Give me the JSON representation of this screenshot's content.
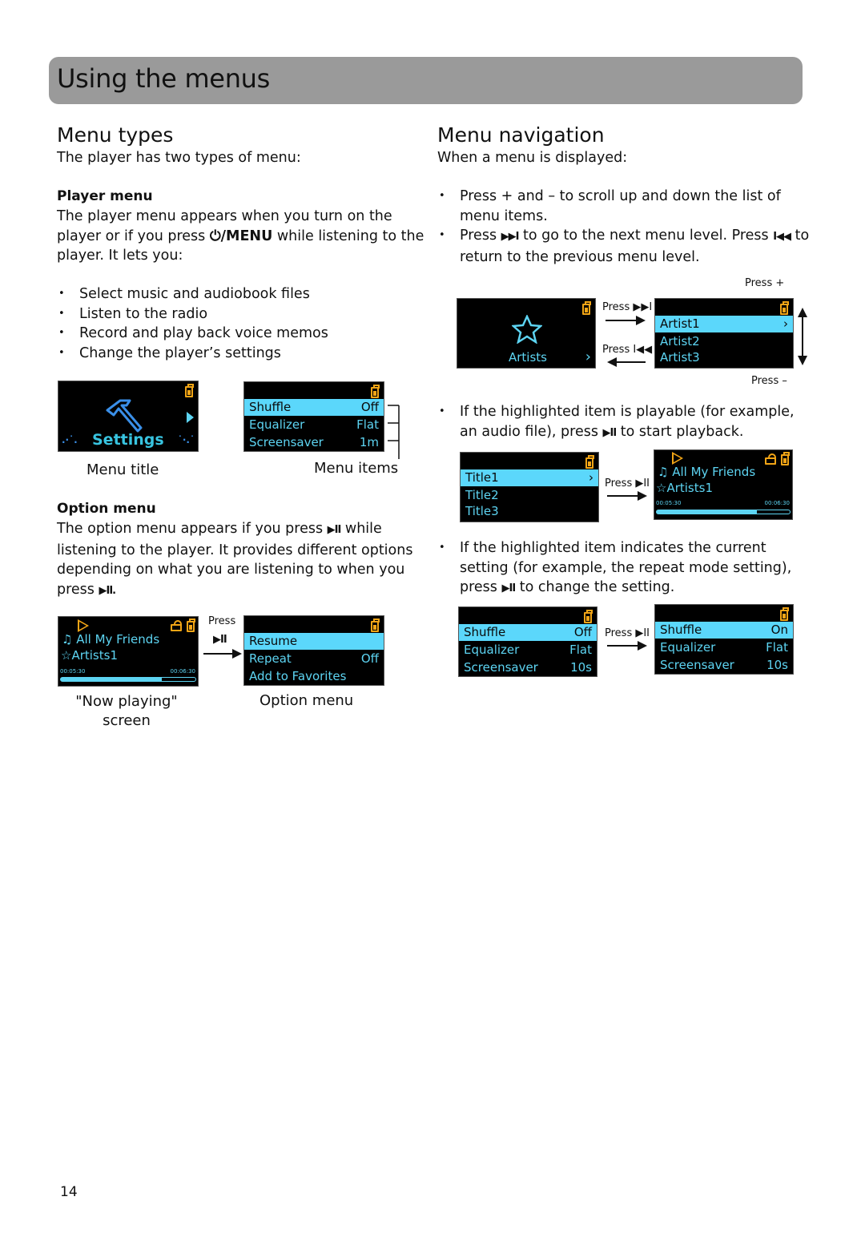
{
  "page": {
    "title": "Using the menus",
    "page_number": "14"
  },
  "menu_types": {
    "heading": "Menu types",
    "intro": "The player has two types of menu:",
    "player_menu": {
      "heading": "Player menu",
      "text_1": "The player menu appears when you turn on the",
      "text_2a": "player or if you press ",
      "text_2_button": "⏻/MENU",
      "text_2b": " while listening to the",
      "text_3": "player. It lets you:",
      "bullets": [
        "Select music and audiobook files",
        "Listen to the radio",
        "Record and play back voice memos",
        "Change the player’s settings"
      ],
      "settings_screen": {
        "title": "Settings"
      },
      "items_screen": {
        "rows": [
          {
            "label": "Shuffle",
            "value": "Off"
          },
          {
            "label": "Equalizer",
            "value": "Flat"
          },
          {
            "label": "Screensaver",
            "value": "1m"
          }
        ]
      },
      "caption_title": "Menu title",
      "caption_items": "Menu items"
    },
    "option_menu": {
      "heading": "Option menu",
      "line_1a": "The option menu appears if you press ",
      "line_1_glyph": "▶II",
      "line_1b": " while",
      "line_2": "listening to the player. It provides different options",
      "line_3": "depending on what you are listening to when you",
      "line_4a": "press ",
      "line_4_glyph": "▶II.",
      "now_playing": {
        "song": "All My Friends",
        "artist": "Artists1",
        "elapsed": "00:05:30",
        "total": "00:06:30",
        "progress_fraction": 0.75
      },
      "press_label": "Press",
      "press_glyph": "▶II",
      "option_screen": {
        "rows": [
          {
            "label": "Resume",
            "value": ""
          },
          {
            "label": "Repeat",
            "value": "Off"
          },
          {
            "label": "Add to Favorites",
            "value": ""
          }
        ]
      },
      "caption_now_playing_1": "\"Now playing\"",
      "caption_now_playing_2": "screen",
      "caption_option": "Option menu"
    }
  },
  "menu_navigation": {
    "heading": "Menu navigation",
    "intro": "When a menu is displayed:",
    "bullet_1_line_1": "Press + and – to scroll up and down the list of",
    "bullet_1_line_2": "menu items.",
    "bullet_2_line_1a": "Press ",
    "bullet_2_next_glyph": "▶▶I",
    "bullet_2_line_1b": " to go to the next menu level. Press ",
    "bullet_2_prev_glyph": "I◀◀",
    "bullet_2_line_1c": " to",
    "bullet_2_line_2": "return to the previous menu level.",
    "fig1": {
      "artists_label": "Artists",
      "press_next": "Press ▶▶I",
      "press_prev": "Press I◀◀",
      "press_plus": "Press +",
      "press_minus": "Press –",
      "rows": [
        "Artist1",
        "Artist2",
        "Artist3"
      ]
    },
    "bullet_3_line_1": "If the highlighted item is playable (for example,",
    "bullet_3_line_2a": "an audio file), press ",
    "bullet_3_glyph": "▶II",
    "bullet_3_line_2b": " to start playback.",
    "fig2": {
      "rows": [
        "Title1",
        "Title2",
        "Title3"
      ],
      "press": "Press ▶II",
      "song": "All My Friends",
      "artist": "Artists1",
      "elapsed": "00:05:30",
      "total": "00:06:30",
      "progress_fraction": 0.75
    },
    "bullet_4_line_1": "If the highlighted item indicates the current",
    "bullet_4_line_2": "setting (for example, the repeat mode setting),",
    "bullet_4_line_3a": "press ",
    "bullet_4_glyph": "▶II",
    "bullet_4_line_3b": " to change the setting.",
    "fig3": {
      "press": "Press ▶II",
      "before": [
        {
          "label": "Shuffle",
          "value": "Off"
        },
        {
          "label": "Equalizer",
          "value": "Flat"
        },
        {
          "label": "Screensaver",
          "value": "10s"
        }
      ],
      "after": [
        {
          "label": "Shuffle",
          "value": "On"
        },
        {
          "label": "Equalizer",
          "value": "Flat"
        },
        {
          "label": "Screensaver",
          "value": "10s"
        }
      ]
    }
  },
  "colors": {
    "header_bg": "#9a9a9a",
    "screen_bg": "#000000",
    "highlight": "#5bd7fb",
    "screen_text": "#5dd4f2",
    "icon_orange": "#f2a516"
  }
}
